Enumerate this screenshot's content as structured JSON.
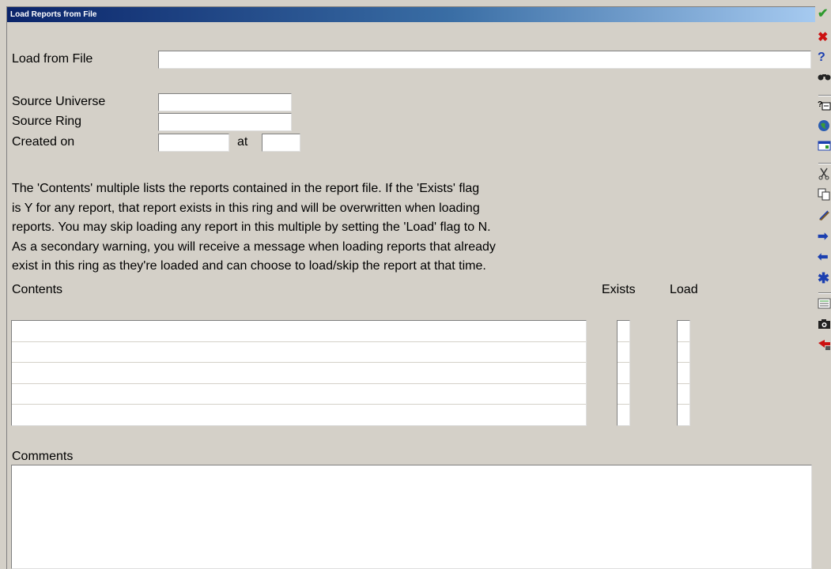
{
  "window": {
    "title": "Load Reports from File"
  },
  "form": {
    "load_from_file_label": "Load from File",
    "load_from_file_value": "",
    "source_universe_label": "Source Universe",
    "source_universe_value": "",
    "source_ring_label": "Source Ring",
    "source_ring_value": "",
    "created_on_label": "Created on",
    "created_on_date": "",
    "at_label": "at",
    "created_on_time": ""
  },
  "info_lines": [
    "The 'Contents' multiple lists the reports contained in the report file. If the 'Exists' flag",
    "is Y for any report, that report exists in this ring and will be overwritten when loading",
    "reports. You may skip loading any report in this multiple by setting the 'Load' flag to N.",
    "As a secondary warning, you will receive a message when loading reports that already",
    "exist in this ring as they're loaded and can choose to load/skip the report at that time."
  ],
  "contents": {
    "label": "Contents",
    "exists_label": "Exists",
    "load_label": "Load",
    "rows": [
      "",
      "",
      "",
      "",
      ""
    ]
  },
  "comments": {
    "label": "Comments",
    "value": ""
  },
  "toolbar_icons": [
    "ok-check-icon",
    "cancel-x-icon",
    "help-icon",
    "binoculars-icon",
    "field-help-icon",
    "globe-icon",
    "calendar-icon",
    "cut-icon",
    "copy-icon",
    "paste-icon",
    "next-arrow-icon",
    "previous-arrow-icon",
    "asterisk-icon",
    "list-icon",
    "camera-icon",
    "exit-icon"
  ],
  "colors": {
    "titlebar_start": "#0a246a",
    "titlebar_end": "#a6caf0",
    "form_bg": "#d4d0c8",
    "check": "#2e9a2e",
    "x": "#cc1111",
    "blue": "#1b3fb0"
  }
}
